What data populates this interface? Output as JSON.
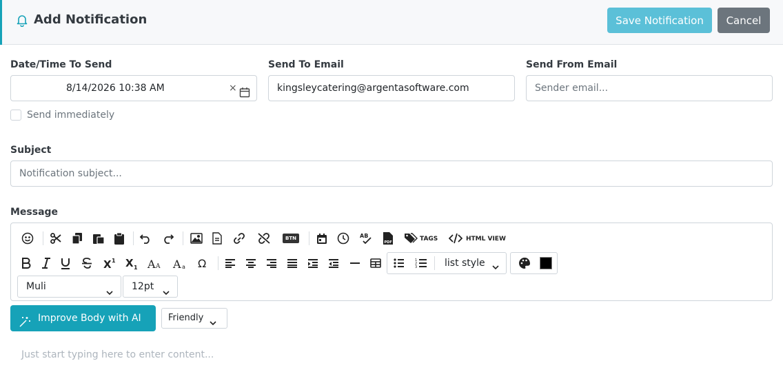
{
  "header": {
    "title": "Add Notification",
    "save_label": "Save Notification",
    "cancel_label": "Cancel"
  },
  "form": {
    "datetime": {
      "label": "Date/Time To Send",
      "value": "8/14/2026 10:38 AM",
      "clear": "×"
    },
    "send_to": {
      "label": "Send To Email",
      "value": "kingsleycatering@argentasoftware.com"
    },
    "send_from": {
      "label": "Send From Email",
      "placeholder": "Sender email..."
    },
    "send_immediately": {
      "label": "Send immediately",
      "checked": false
    },
    "subject": {
      "label": "Subject",
      "placeholder": "Notification subject..."
    },
    "message": {
      "label": "Message"
    }
  },
  "toolbar": {
    "btn_label": "BTN",
    "tags_label": "TAGS",
    "html_view_label": "HTML VIEW",
    "list_style": "list style",
    "font_family": "Muli",
    "font_size": "12pt",
    "text_color": "#000000"
  },
  "ai": {
    "improve_label": "Improve Body with AI",
    "tone": "Friendly"
  },
  "editor": {
    "placeholder": "Just start typing here to enter content..."
  },
  "colors": {
    "accent": "#16a2b8",
    "save_button": "#5bc0d8",
    "cancel_button": "#6c757d"
  }
}
